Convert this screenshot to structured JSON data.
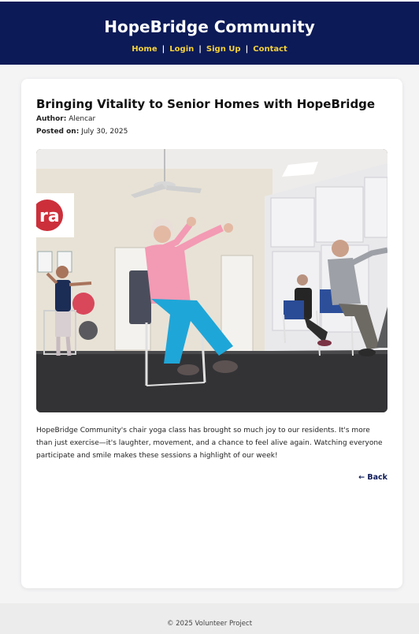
{
  "header": {
    "site_title": "HopeBridge Community",
    "nav": [
      {
        "label": "Home"
      },
      {
        "label": "Login"
      },
      {
        "label": "Sign Up"
      },
      {
        "label": "Contact"
      }
    ],
    "separator": "|"
  },
  "post": {
    "title": "Bringing Vitality to Senior Homes with HopeBridge",
    "author_label": "Author:",
    "author": "Alencar",
    "posted_label": "Posted on:",
    "posted_date": "July 30, 2025",
    "image_sign_text": "ra",
    "body": "HopeBridge Community's chair yoga class has brought so much joy to our residents. It's more than just exercise—it's laughter, movement, and a chance to feel alive again. Watching everyone participate and smile makes these sessions a highlight of our week!",
    "back_label": "← Back"
  },
  "footer": {
    "copyright": "© 2025 Volunteer Project"
  },
  "colors": {
    "header_bg": "#0c1a57",
    "nav_link": "#f6d23a",
    "back_link": "#0c1a57"
  }
}
